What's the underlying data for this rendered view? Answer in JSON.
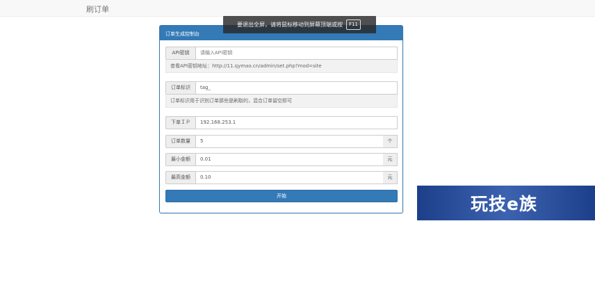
{
  "header": {
    "brand": "刷订单"
  },
  "fullscreen_notice": {
    "text": "要退出全屏，请将鼠标移动到屏幕顶端或按",
    "key": "F11"
  },
  "panel": {
    "title": "订单生成控制台",
    "api_key": {
      "label": "API密钥",
      "placeholder": "请输入API密钥",
      "help": "查看API密钥地址：http://11.qymao.cn/admin/set.php?mod=site"
    },
    "order_tag": {
      "label": "订单标识",
      "value": "tag_",
      "help": "订单标识用于识别订单那些是刷取的，混合订单留空即可"
    },
    "order_ip": {
      "label": "下单ＩＰ",
      "value": "192.168.253.1"
    },
    "order_count": {
      "label": "订单数量",
      "value": "5",
      "unit": "个"
    },
    "min_amount": {
      "label": "最小金额",
      "value": "0.01",
      "unit": "元"
    },
    "max_amount": {
      "label": "最高金额",
      "value": "0.10",
      "unit": "元"
    },
    "start_button": "开始"
  },
  "ad": {
    "text": "玩技e族"
  },
  "colors": {
    "primary": "#337ab7",
    "addon_bg": "#eeeeee",
    "ad_bg": "#2a4f9e"
  }
}
